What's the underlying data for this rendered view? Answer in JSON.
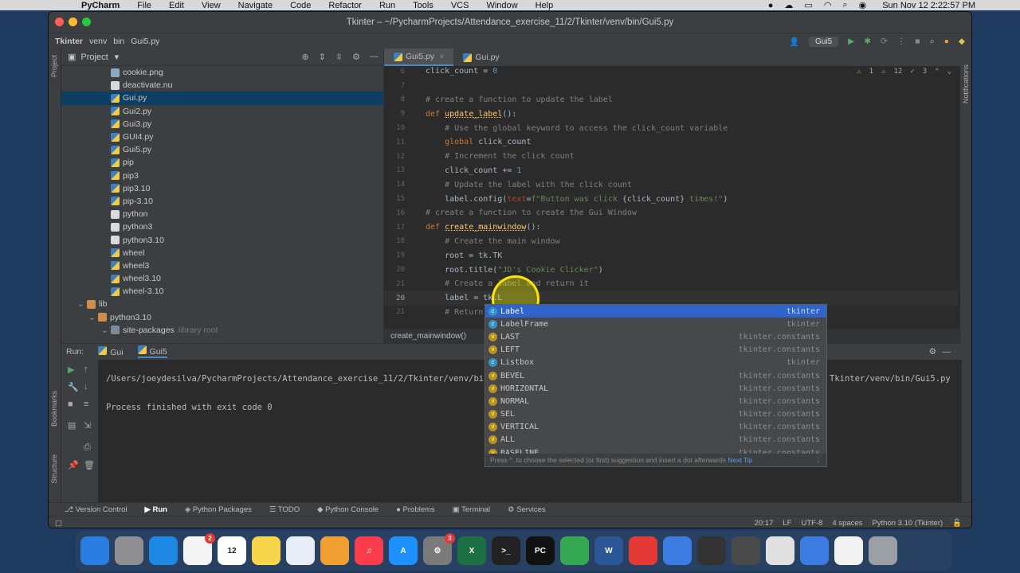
{
  "menubar": {
    "app": "PyCharm",
    "items": [
      "File",
      "Edit",
      "View",
      "Navigate",
      "Code",
      "Refactor",
      "Run",
      "Tools",
      "VCS",
      "Window",
      "Help"
    ],
    "clock": "Sun Nov 12  2:22:57 PM"
  },
  "window": {
    "title": "Tkinter – ~/PycharmProjects/Attendance_exercise_11/2/Tkinter/venv/bin/Gui5.py"
  },
  "navbar": {
    "crumbs": [
      "Tkinter",
      "venv",
      "bin",
      "Gui5.py"
    ],
    "run_config": "Gui5"
  },
  "project": {
    "header": "Project",
    "items": [
      {
        "label": "cookie.png",
        "type": "img",
        "indent": 78
      },
      {
        "label": "deactivate.nu",
        "type": "file",
        "indent": 78
      },
      {
        "label": "Gui.py",
        "type": "py",
        "indent": 78,
        "selected": true
      },
      {
        "label": "Gui2.py",
        "type": "py",
        "indent": 78
      },
      {
        "label": "Gui3.py",
        "type": "py",
        "indent": 78
      },
      {
        "label": "GUI4.py",
        "type": "py",
        "indent": 78
      },
      {
        "label": "Gui5.py",
        "type": "py",
        "indent": 78
      },
      {
        "label": "pip",
        "type": "py",
        "indent": 78
      },
      {
        "label": "pip3",
        "type": "py",
        "indent": 78
      },
      {
        "label": "pip3.10",
        "type": "py",
        "indent": 78
      },
      {
        "label": "pip-3.10",
        "type": "py",
        "indent": 78
      },
      {
        "label": "python",
        "type": "file",
        "indent": 78
      },
      {
        "label": "python3",
        "type": "file",
        "indent": 78
      },
      {
        "label": "python3.10",
        "type": "file",
        "indent": 78
      },
      {
        "label": "wheel",
        "type": "py",
        "indent": 78
      },
      {
        "label": "wheel3",
        "type": "py",
        "indent": 78
      },
      {
        "label": "wheel3.10",
        "type": "py",
        "indent": 78
      },
      {
        "label": "wheel-3.10",
        "type": "py",
        "indent": 78
      },
      {
        "label": "lib",
        "type": "folder",
        "indent": 48,
        "arrow": "⌄"
      },
      {
        "label": "python3.10",
        "type": "folder",
        "indent": 62,
        "arrow": "⌄"
      },
      {
        "label": "site-packages",
        "type": "pkg",
        "indent": 78,
        "arrow": "⌄",
        "note": "library root"
      }
    ]
  },
  "editor": {
    "tabs": [
      "Gui5.py",
      "Gui.py"
    ],
    "inspections": {
      "warnings": "1",
      "weak": "12",
      "typos": "3"
    },
    "lines": [
      {
        "n": "6",
        "html": "click_count = <span class=\"num\">0</span>"
      },
      {
        "n": "7",
        "html": ""
      },
      {
        "n": "8",
        "html": "<span class=\"cm\"># create a function to update the label</span>"
      },
      {
        "n": "9",
        "html": "<span class=\"kw\">def</span> <span class=\"fn\">update_label</span>():"
      },
      {
        "n": "10",
        "html": "    <span class=\"cm\"># Use the global keyword to access the click_count variable</span>"
      },
      {
        "n": "11",
        "html": "    <span class=\"kw\">global</span> click_count"
      },
      {
        "n": "12",
        "html": "    <span class=\"cm\"># Increment the click count</span>"
      },
      {
        "n": "13",
        "html": "    click_count += <span class=\"num\">1</span>"
      },
      {
        "n": "14",
        "html": "    <span class=\"cm\"># Update the label with the click count</span>"
      },
      {
        "n": "15",
        "html": "    label.config(<span class=\"pr\">text</span>=<span class=\"st\">f\"Button was click </span>{click_count}<span class=\"st\"> times!\"</span>)"
      },
      {
        "n": "16",
        "html": "<span class=\"cm\"># create a function to create the Gui Window</span>"
      },
      {
        "n": "17",
        "html": "<span class=\"kw\">def</span> <span class=\"fn\">create_mainwindow</span>():"
      },
      {
        "n": "18",
        "html": "    <span class=\"cm\"># Create the main window</span>"
      },
      {
        "n": "19",
        "html": "    root = tk.TK"
      },
      {
        "n": "20",
        "html": "    root.title(<span class=\"st\">\"JD's Cookie Clicker\"</span>)"
      },
      {
        "n": "21",
        "html": "    <span class=\"cm\"># Create a label and return it</span>"
      },
      {
        "n": "20",
        "html": "    label = tk.L",
        "current": true
      },
      {
        "n": "21",
        "html": "    <span class=\"cm\"># Return</span>"
      }
    ],
    "breadcrumb": "create_mainwindow()"
  },
  "completion": {
    "items": [
      {
        "kind": "c",
        "name": "Label",
        "src": "tkinter",
        "selected": true
      },
      {
        "kind": "c",
        "name": "LabelFrame",
        "src": "tkinter"
      },
      {
        "kind": "v",
        "name": "LAST",
        "src": "tkinter.constants"
      },
      {
        "kind": "v",
        "name": "LEFT",
        "src": "tkinter.constants"
      },
      {
        "kind": "c",
        "name": "Listbox",
        "src": "tkinter"
      },
      {
        "kind": "v",
        "name": "BEVEL",
        "src": "tkinter.constants"
      },
      {
        "kind": "v",
        "name": "HORIZONTAL",
        "src": "tkinter.constants"
      },
      {
        "kind": "v",
        "name": "NORMAL",
        "src": "tkinter.constants"
      },
      {
        "kind": "v",
        "name": "SEL",
        "src": "tkinter.constants"
      },
      {
        "kind": "v",
        "name": "VERTICAL",
        "src": "tkinter.constants"
      },
      {
        "kind": "v",
        "name": "ALL",
        "src": "tkinter.constants"
      },
      {
        "kind": "v",
        "name": "BASELINE",
        "src": "tkinter.constants"
      }
    ],
    "footer": "Press ^. to choose the selected (or first) suggestion and insert a dot afterwards",
    "next_tip": "Next Tip"
  },
  "run": {
    "label": "Run:",
    "tabs": [
      "Gui",
      "Gui5"
    ],
    "command": "/Users/joeydesilva/PycharmProjects/Attendance_exercise_11/2/Tkinter/venv/bi",
    "command_tail": "Tkinter/venv/bin/Gui5.py",
    "exit_message": "Process finished with exit code 0"
  },
  "toolwindows": [
    "Version Control",
    "Run",
    "Python Packages",
    "TODO",
    "Python Console",
    "Problems",
    "Terminal",
    "Services"
  ],
  "statusbar": [
    "20:17",
    "LF",
    "UTF-8",
    "4 spaces",
    "Python 3.10 (Tkinter)"
  ],
  "leftstrip": [
    "Project",
    "Bookmarks",
    "Structure"
  ],
  "rightstrip": "Notifications",
  "dock": [
    {
      "name": "finder",
      "color": "#2a7de1",
      "label": ""
    },
    {
      "name": "launchpad",
      "color": "#8e8e93",
      "label": ""
    },
    {
      "name": "safari",
      "color": "#1e88e5",
      "label": ""
    },
    {
      "name": "reminders",
      "color": "#f5f5f5",
      "label": "",
      "badge": "2"
    },
    {
      "name": "calendar",
      "color": "#ffffff",
      "label": "12"
    },
    {
      "name": "notes",
      "color": "#f7d54a",
      "label": ""
    },
    {
      "name": "freeform",
      "color": "#e8eef8",
      "label": ""
    },
    {
      "name": "photos",
      "color": "#f0a030",
      "label": ""
    },
    {
      "name": "music",
      "color": "#fa3c4c",
      "label": "♫"
    },
    {
      "name": "app-store",
      "color": "#1e90ff",
      "label": "A"
    },
    {
      "name": "system-settings",
      "color": "#7a7a7a",
      "label": "⚙",
      "badge": "3"
    },
    {
      "name": "excel",
      "color": "#1d7044",
      "label": "X"
    },
    {
      "name": "terminal",
      "color": "#222222",
      "label": ">_"
    },
    {
      "name": "pycharm",
      "color": "#111111",
      "label": "PC"
    },
    {
      "name": "chrome",
      "color": "#34a853",
      "label": ""
    },
    {
      "name": "word",
      "color": "#2b5797",
      "label": "W"
    },
    {
      "name": "screencast",
      "color": "#e53935",
      "label": ""
    },
    {
      "name": "assistant",
      "color": "#3c7be0",
      "label": ""
    },
    {
      "name": "window-1",
      "color": "#333333",
      "label": ""
    },
    {
      "name": "window-2",
      "color": "#4a4a4a",
      "label": ""
    },
    {
      "name": "window-3",
      "color": "#e0e0e0",
      "label": ""
    },
    {
      "name": "assistant-2",
      "color": "#3c7be0",
      "label": ""
    },
    {
      "name": "window-4",
      "color": "#f2f2f2",
      "label": ""
    },
    {
      "name": "trash",
      "color": "#9aa0a6",
      "label": ""
    }
  ]
}
